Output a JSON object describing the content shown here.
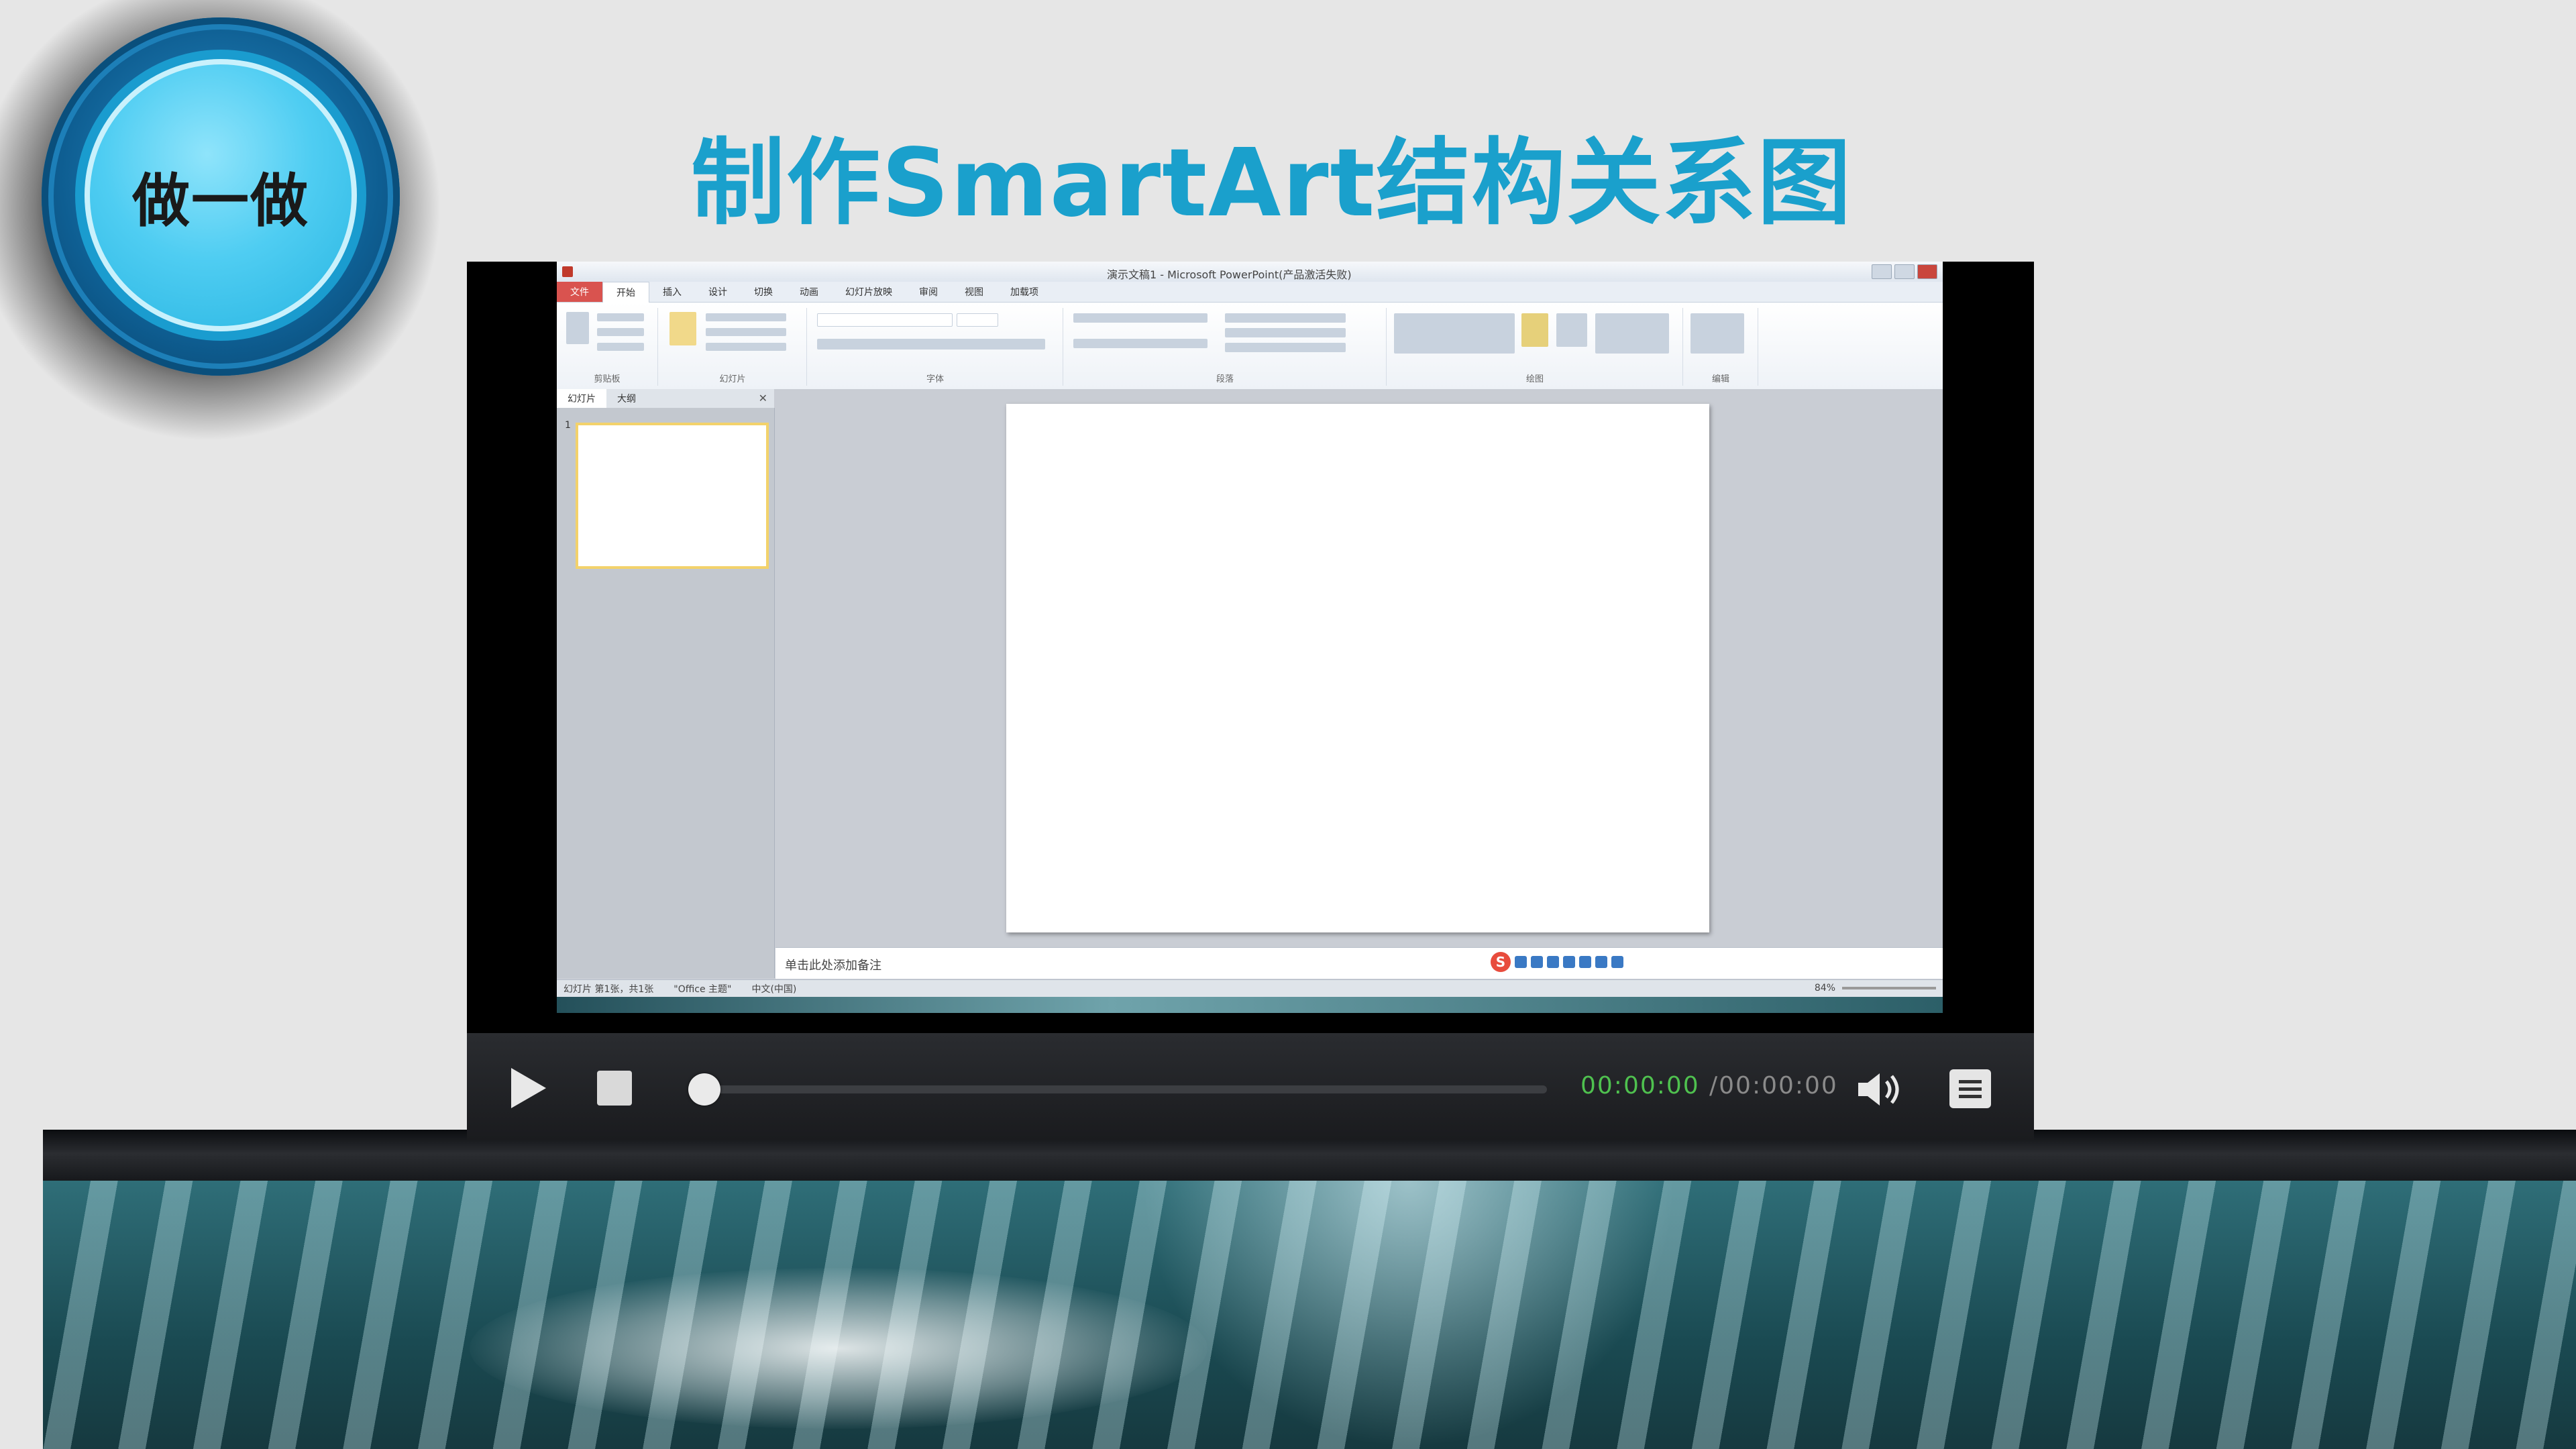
{
  "badge": {
    "label": "做一做"
  },
  "page": {
    "title": "制作SmartArt结构关系图"
  },
  "app": {
    "window_title": "演示文稿1 - Microsoft PowerPoint(产品激活失败)",
    "tabs": [
      "文件",
      "开始",
      "插入",
      "设计",
      "切换",
      "动画",
      "幻灯片放映",
      "审阅",
      "视图",
      "加载项"
    ],
    "ribbon_groups": [
      "剪贴板",
      "幻灯片",
      "字体",
      "段落",
      "绘图",
      "编辑"
    ],
    "pane_tabs": [
      "幻灯片",
      "大纲"
    ],
    "thumb_number": "1",
    "notes_placeholder": "单击此处添加备注",
    "status": {
      "slide": "幻灯片 第1张，共1张",
      "theme": "\"Office 主题\"",
      "language": "中文(中国)",
      "zoom": "84%"
    }
  },
  "player": {
    "time_current": "00:00:00",
    "time_total": "/00:00:00",
    "progress": 0
  }
}
